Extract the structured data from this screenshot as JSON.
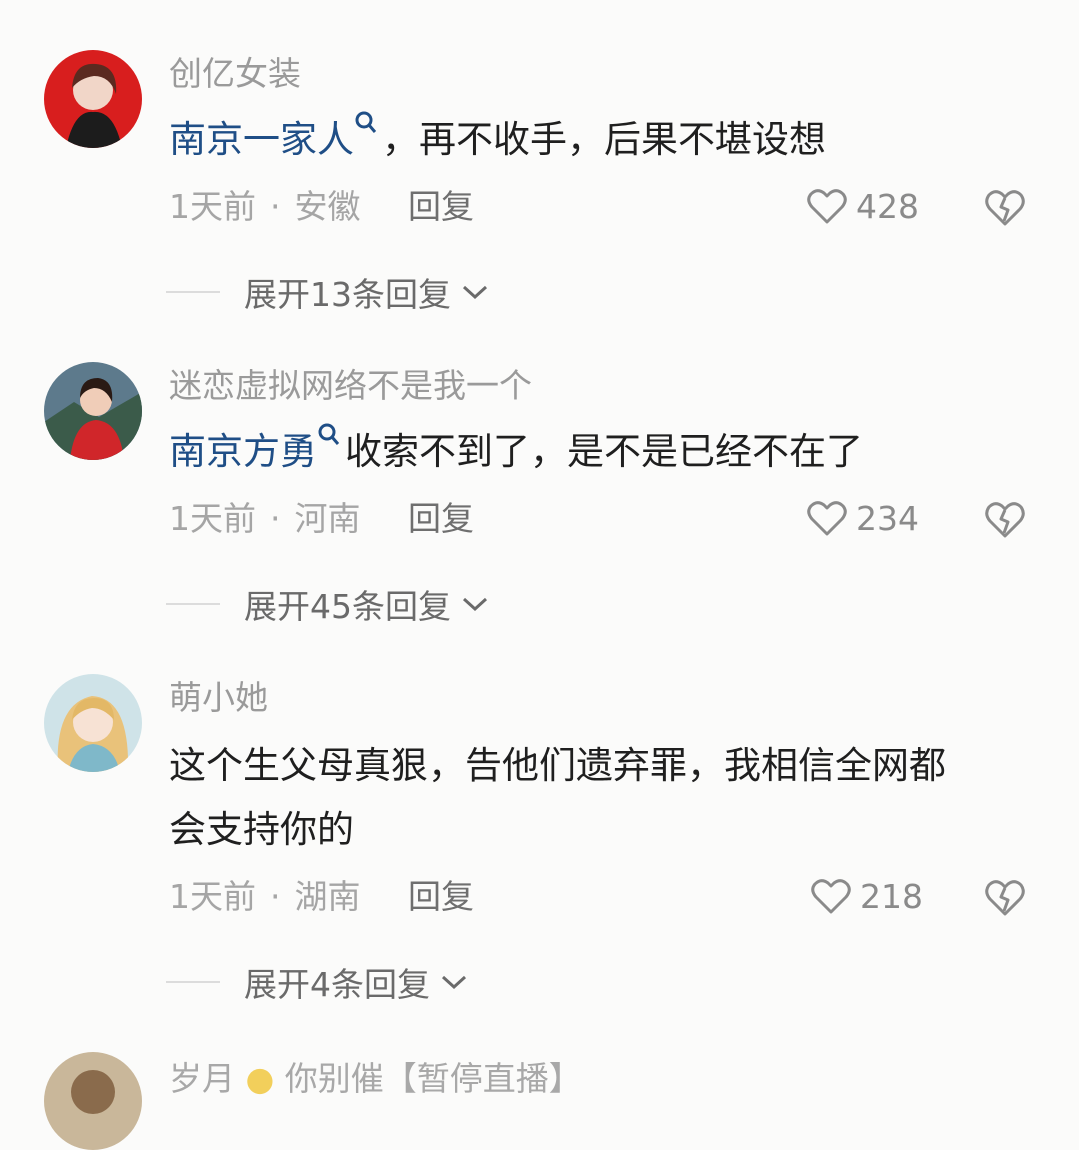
{
  "comments": [
    {
      "username": "创亿女装",
      "mention": "南京一家人",
      "text": "，再不收手，后果不堪设想",
      "text_line2": "",
      "time": "1天前",
      "location": "安徽",
      "reply_label": "回复",
      "likes": "428",
      "expand_label": "展开13条回复"
    },
    {
      "username": "迷恋虚拟网络不是我一个",
      "mention": "南京方勇",
      "text": "收索不到了，是不是已经不在了",
      "text_line2": "",
      "time": "1天前",
      "location": "河南",
      "reply_label": "回复",
      "likes": "234",
      "expand_label": "展开45条回复"
    },
    {
      "username": "萌小她",
      "mention": "",
      "text": "这个生父母真狠，告他们遗弃罪，我相信全网都",
      "text_line2": "会支持你的",
      "time": "1天前",
      "location": "湖南",
      "reply_label": "回复",
      "likes": "218",
      "expand_label": "展开4条回复"
    }
  ],
  "partial_comment": {
    "username": "岁月",
    "username_suffix": "你别催【暂停直播】"
  },
  "colors": {
    "background": "#fbfbfa",
    "mention": "#1f4e86",
    "username": "#9a9a9a",
    "body": "#1f1f1f"
  },
  "icons": [
    "search-icon",
    "heart-icon",
    "broken-heart-icon",
    "chevron-down-icon"
  ]
}
